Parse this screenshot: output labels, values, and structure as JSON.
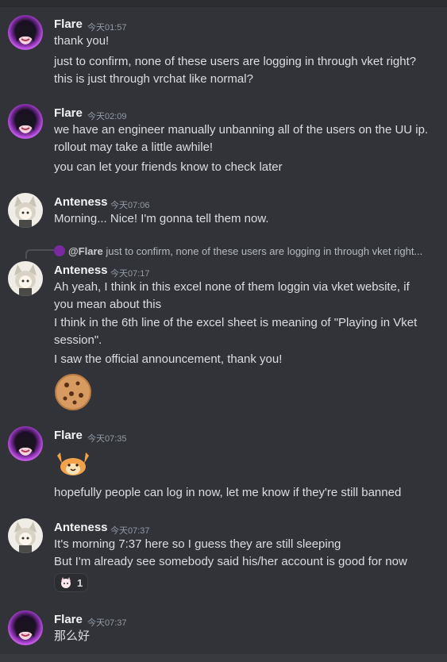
{
  "messages": [
    {
      "author": "Flare",
      "time": "今天01:57",
      "lines": [
        "thank you!",
        "just to confirm, none of these users are logging in through vket right?",
        "this is just through vrchat like normal?"
      ]
    },
    {
      "author": "Flare",
      "time": "今天02:09",
      "lines": [
        "we have an engineer manually unbanning all of the users on the UU ip.",
        "rollout may take a little awhile!",
        "you can let your friends know to check later"
      ]
    },
    {
      "author": "Anteness",
      "time": "今天07:06",
      "lines": [
        "Morning... Nice! I'm gonna tell them now."
      ]
    },
    {
      "author": "Anteness",
      "time": "今天07:17",
      "reply": {
        "author": "@Flare",
        "text": "just to confirm, none of these users are logging in through vket right..."
      },
      "lines": [
        "Ah yeah, I think in this excel none of them loggin via vket website, if",
        "you mean about this",
        "I think in the 6th line of the excel sheet is meaning of \"Playing in Vket",
        "session\".",
        "I saw the official announcement, thank you!"
      ],
      "emoji": "cookie"
    },
    {
      "author": "Flare",
      "time": "今天07:35",
      "emoji": "hamster-cheering",
      "lines": [
        "hopefully people can log in now, let me know if they're still banned"
      ]
    },
    {
      "author": "Anteness",
      "time": "今天07:37",
      "lines": [
        "It's morning 7:37 here so I guess they are still sleeping",
        "But I'm already see somebody said his/her account is good for now"
      ],
      "reaction": {
        "emoji": "cat-emoji",
        "count": "1"
      }
    },
    {
      "author": "Flare",
      "time": "今天07:37",
      "lines": [
        "那么好"
      ]
    }
  ]
}
